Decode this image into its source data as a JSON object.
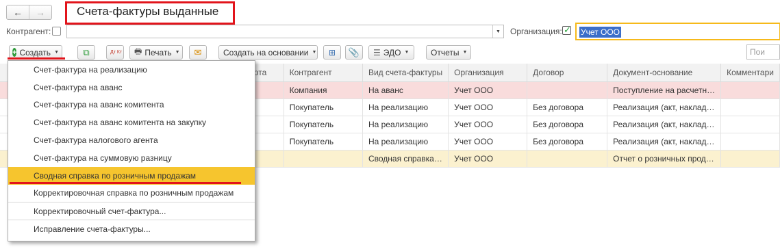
{
  "nav": {
    "back": "←",
    "forward": "→"
  },
  "title": "Счета-фактуры выданные",
  "filters": {
    "counterparty_label": "Контрагент:",
    "counterparty_value": "",
    "organization_label": "Организация:",
    "organization_value": "Учет ООО",
    "search_placeholder": "Пои"
  },
  "toolbar": {
    "create": "Создать",
    "print": "Печать",
    "create_based_on": "Создать на основании",
    "edo": "ЭДО",
    "reports": "Отчеты",
    "dt_kt": "Дт Кт"
  },
  "table": {
    "headers": [
      "алюта",
      "Контрагент",
      "Вид счета-фактуры",
      "Организация",
      "Договор",
      "Документ-основание",
      "Комментари"
    ],
    "rows": [
      [
        "уб.",
        "Компания",
        "На аванс",
        "Учет ООО",
        "",
        "Поступление на расчетн…",
        ""
      ],
      [
        "уб.",
        "Покупатель",
        "На реализацию",
        "Учет ООО",
        "Без договора",
        "Реализация (акт, наклад…",
        ""
      ],
      [
        "уб.",
        "Покупатель",
        "На реализацию",
        "Учет ООО",
        "Без договора",
        "Реализация (акт, наклад…",
        ""
      ],
      [
        "уб.",
        "Покупатель",
        "На реализацию",
        "Учет ООО",
        "Без договора",
        "Реализация (акт, наклад…",
        ""
      ],
      [
        "уб.",
        "",
        "Сводная справка…",
        "Учет ООО",
        "",
        "Отчет о розничных прод…",
        ""
      ]
    ]
  },
  "menu": {
    "items": [
      "Счет-фактура на реализацию",
      "Счет-фактура на аванс",
      "Счет-фактура на аванс комитента",
      "Счет-фактура на аванс комитента на закупку",
      "Счет-фактура налогового агента",
      "Счет-фактура на суммовую разницу",
      "Сводная справка по розничным продажам",
      "Корректировочная справка по розничным продажам",
      "Корректировочный счет-фактура...",
      "Исправление счета-фактуры..."
    ]
  },
  "colors": {
    "highlight": "#f6c52e",
    "annotation": "#e2141b",
    "selection": "#3b6ec9"
  }
}
